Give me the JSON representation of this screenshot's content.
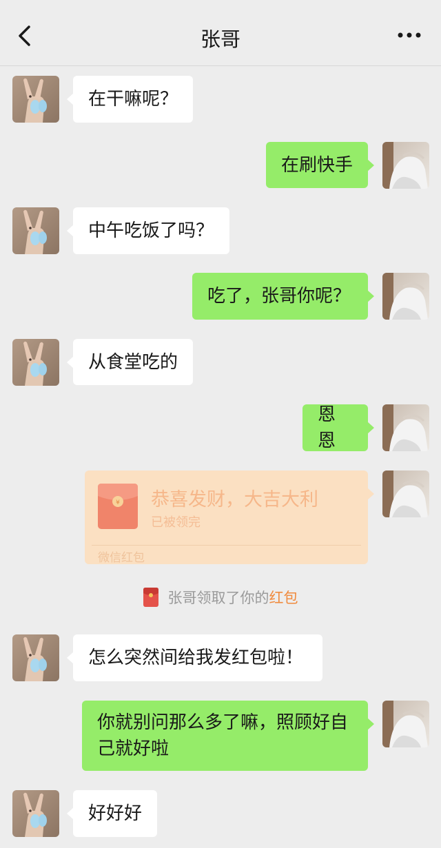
{
  "header": {
    "title": "张哥",
    "back_icon": "chevron-left-icon",
    "more_icon": "more-dots-icon"
  },
  "messages": [
    {
      "side": "in",
      "text": "在干嘛呢？"
    },
    {
      "side": "out",
      "text": "在刷快手"
    },
    {
      "side": "in",
      "text": "中午吃饭了吗？"
    },
    {
      "side": "out",
      "text": "吃了，张哥你呢？"
    },
    {
      "side": "in",
      "text": "从食堂吃的"
    },
    {
      "side": "out",
      "text": "恩恩"
    },
    {
      "side": "in",
      "text": "怎么突然间给我发红包啦！"
    },
    {
      "side": "out",
      "line1": "你就别问那么多了嘛，照顾好自",
      "line2": "己就好啦"
    },
    {
      "side": "in",
      "text": "好好好"
    }
  ],
  "red_packet": {
    "title": "恭喜发财，大吉大利",
    "status": "已被领完",
    "footer": "微信红包",
    "color": "#fbe0c2"
  },
  "system_notice": {
    "prefix": "张哥领取了你的",
    "link": "红包",
    "icon": "red-packet-icon"
  },
  "colors": {
    "outgoing_bubble": "#95ec69",
    "incoming_bubble": "#ffffff",
    "background": "#ededed",
    "link": "#f08a3d"
  }
}
